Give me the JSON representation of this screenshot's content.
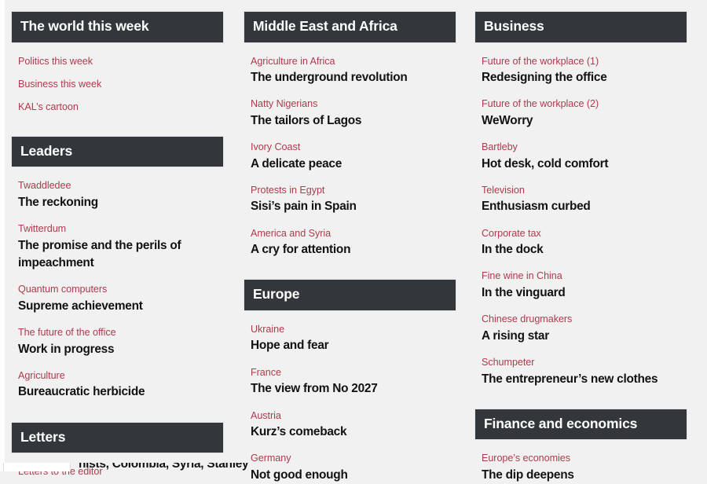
{
  "page": {
    "background_color": "#f1f1f1",
    "header_background_color": "#33363b",
    "header_text_color": "#ffffff",
    "rubric_color": "#ad3b4c",
    "headline_color": "#121212"
  },
  "columns": [
    {
      "name": "column-left",
      "sections": [
        {
          "title": "The world this week",
          "articles": [
            {
              "rubric": "Politics this week",
              "headline": ""
            },
            {
              "rubric": "Business this week",
              "headline": ""
            },
            {
              "rubric": "KAL’s cartoon",
              "headline": ""
            }
          ]
        },
        {
          "title": "Leaders",
          "articles": [
            {
              "rubric": "Twaddledee",
              "headline": "The reckoning"
            },
            {
              "rubric": "Twitterdum",
              "headline": "The promise and the perils of impeachment"
            },
            {
              "rubric": "Quantum computers",
              "headline": "Supreme achievement"
            },
            {
              "rubric": "The future of the office",
              "headline": "Work in progress"
            },
            {
              "rubric": "Agriculture",
              "headline": "Bureaucratic herbicide"
            }
          ]
        },
        {
          "title": "Letters",
          "articles": [
            {
              "rubric": "Letters to the editor",
              "headline": ""
            }
          ]
        }
      ]
    },
    {
      "name": "column-middle",
      "sections": [
        {
          "title": "Middle East and Africa",
          "articles": [
            {
              "rubric": "Agriculture in Africa",
              "headline": "The underground revolution"
            },
            {
              "rubric": "Natty Nigerians",
              "headline": "The tailors of Lagos"
            },
            {
              "rubric": "Ivory Coast",
              "headline": "A delicate peace"
            },
            {
              "rubric": "Protests in Egypt",
              "headline": "Sisi’s pain in Spain"
            },
            {
              "rubric": "America and Syria",
              "headline": "A cry for attention"
            }
          ]
        },
        {
          "title": "Europe",
          "articles": [
            {
              "rubric": "Ukraine",
              "headline": "Hope and fear"
            },
            {
              "rubric": "France",
              "headline": "The view from No 2027"
            },
            {
              "rubric": "Austria",
              "headline": "Kurz’s comeback"
            },
            {
              "rubric": "Germany",
              "headline": "Not good enough"
            }
          ]
        }
      ]
    },
    {
      "name": "column-right",
      "sections": [
        {
          "title": "Business",
          "articles": [
            {
              "rubric": "Future of the workplace (1)",
              "headline": "Redesigning the office"
            },
            {
              "rubric": "Future of the workplace (2)",
              "headline": "WeWorry"
            },
            {
              "rubric": "Bartleby",
              "headline": "Hot desk, cold comfort"
            },
            {
              "rubric": "Television",
              "headline": "Enthusiasm curbed"
            },
            {
              "rubric": "Corporate tax",
              "headline": "In the dock"
            },
            {
              "rubric": "Fine wine in China",
              "headline": "In the vinguard"
            },
            {
              "rubric": "Chinese drugmakers",
              "headline": "A rising star"
            },
            {
              "rubric": "Schumpeter",
              "headline": "The entrepreneur’s new clothes"
            }
          ]
        },
        {
          "title": "Finance and economics",
          "articles": [
            {
              "rubric": "Europe’s economies",
              "headline": "The dip deepens"
            }
          ]
        }
      ]
    }
  ],
  "bottom_clipped_row": {
    "partial_text": "nists, Colombia, Syria, Stanley"
  }
}
